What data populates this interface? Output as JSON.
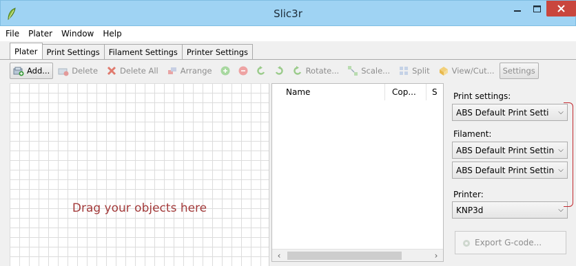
{
  "window": {
    "title": "Slic3r"
  },
  "menu": [
    "File",
    "Plater",
    "Window",
    "Help"
  ],
  "tabs": [
    "Plater",
    "Print Settings",
    "Filament Settings",
    "Printer Settings"
  ],
  "toolbar": {
    "add": "Add...",
    "delete": "Delete",
    "delete_all": "Delete All",
    "arrange": "Arrange",
    "rotate": "Rotate...",
    "scale": "Scale...",
    "split": "Split",
    "view_cut": "View/Cut...",
    "settings": "Settings"
  },
  "canvas": {
    "hint": "Drag your objects here"
  },
  "object_list": {
    "columns": [
      "Name",
      "Cop...",
      "S"
    ]
  },
  "sidebar": {
    "print_settings_label": "Print settings:",
    "print_settings_value": "ABS Default Print Setti",
    "filament_label": "Filament:",
    "filament_values": [
      "ABS Default Print Settinç",
      "ABS Default Print Settinç"
    ],
    "printer_label": "Printer:",
    "printer_value": "KNP3d",
    "export_label": "Export G-code..."
  },
  "colors": {
    "titlebar": "#9fd3f3",
    "close": "#c9463d",
    "hint": "#a33a3a",
    "bracket": "#c2272d"
  }
}
